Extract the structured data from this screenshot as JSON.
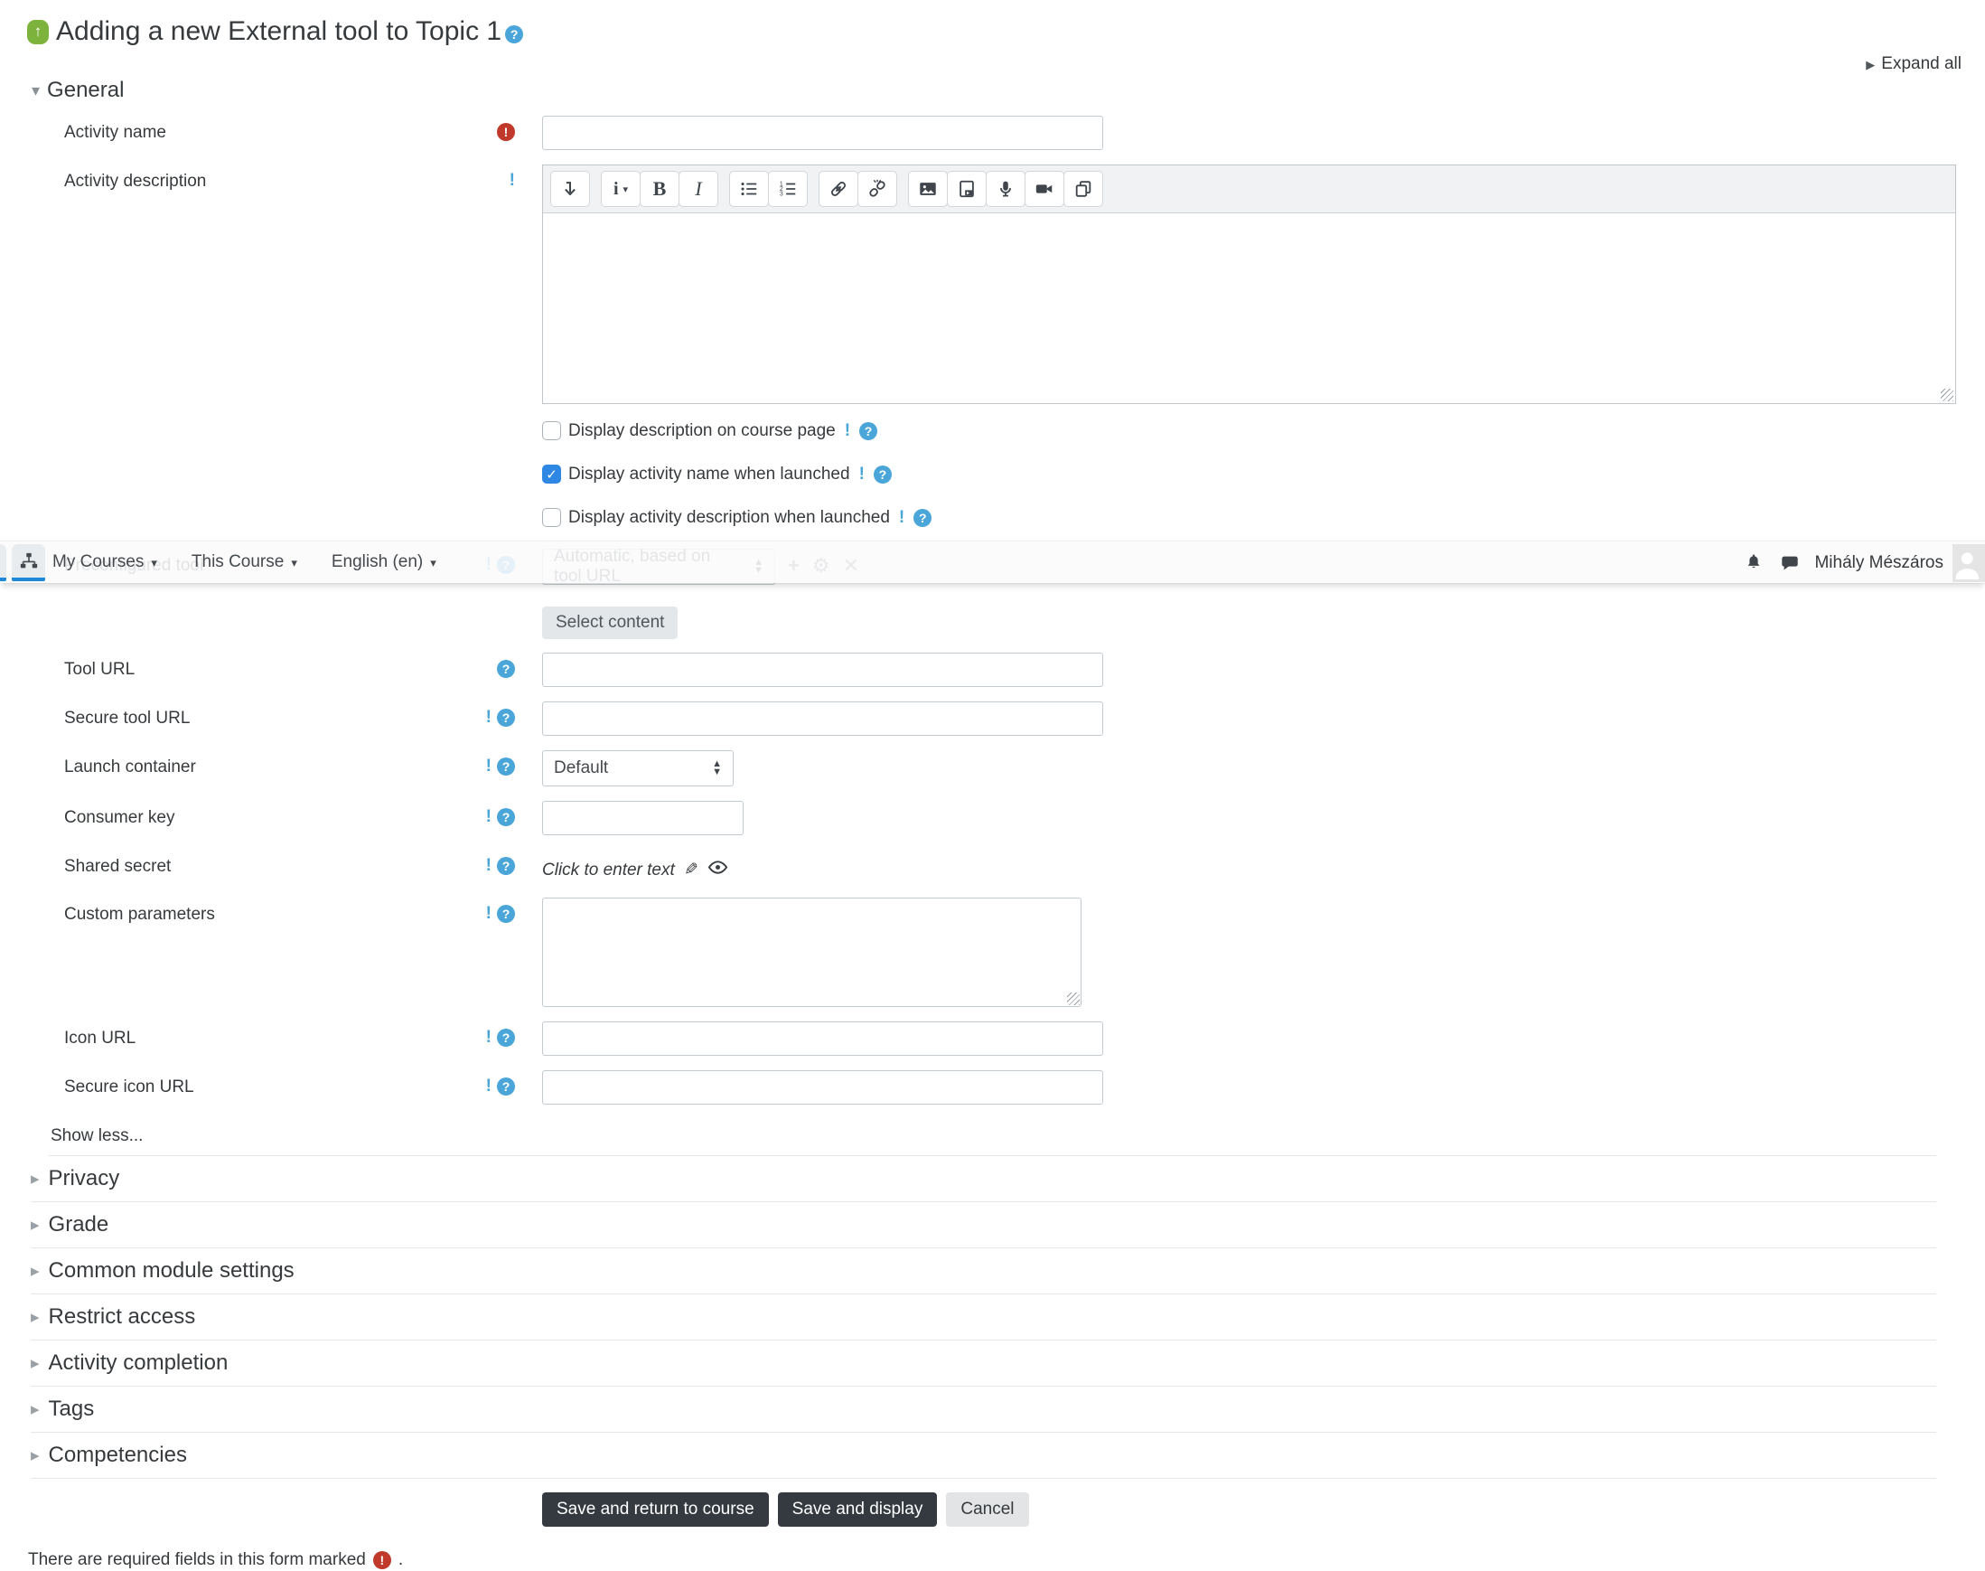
{
  "header": {
    "title": "Adding a new External tool to Topic 1",
    "expand_all_label": "Expand all"
  },
  "navbar": {
    "menus": [
      "My Courses",
      "This Course",
      "English (en)"
    ],
    "user_name": "Mihály Mészáros",
    "icons": [
      "site-navigation-icon",
      "notifications-bell-icon",
      "messages-icon",
      "avatar"
    ]
  },
  "general_section": {
    "label": "General"
  },
  "fields": {
    "activity_name": {
      "label": "Activity name",
      "value": "",
      "required": true
    },
    "activity_description": {
      "label": "Activity description",
      "value": ""
    },
    "editor_toolbar_icons": [
      "collapse-toolbar",
      "paragraph-styles",
      "bold",
      "italic",
      "unordered-list",
      "ordered-list",
      "link",
      "unlink",
      "image",
      "media",
      "record-audio",
      "record-video",
      "manage-files"
    ],
    "checkboxes": [
      {
        "label": "Display description on course page",
        "checked": false
      },
      {
        "label": "Display activity name when launched",
        "checked": true
      },
      {
        "label": "Display activity description when launched",
        "checked": false
      }
    ],
    "preconfigured_tool": {
      "label": "Preconfigured tool",
      "select_value": "Automatic, based on tool URL"
    },
    "select_content_label": "Select content",
    "tool_url": {
      "label": "Tool URL",
      "value": ""
    },
    "secure_tool_url": {
      "label": "Secure tool URL",
      "value": ""
    },
    "launch_container": {
      "label": "Launch container",
      "select_value": "Default"
    },
    "consumer_key": {
      "label": "Consumer key",
      "value": ""
    },
    "shared_secret": {
      "label": "Shared secret",
      "value_text": "Click to enter text"
    },
    "custom_parameters": {
      "label": "Custom parameters",
      "value": ""
    },
    "icon_url": {
      "label": "Icon URL",
      "value": ""
    },
    "secure_icon_url": {
      "label": "Secure icon URL",
      "value": ""
    }
  },
  "show_less_label": "Show less...",
  "collapsed_sections": [
    {
      "label": "Privacy"
    },
    {
      "label": "Grade"
    },
    {
      "label": "Common module settings"
    },
    {
      "label": "Restrict access"
    },
    {
      "label": "Activity completion"
    },
    {
      "label": "Tags"
    },
    {
      "label": "Competencies"
    }
  ],
  "actions": {
    "save_return_label": "Save and return to course",
    "save_display_label": "Save and display",
    "cancel_label": "Cancel"
  },
  "footer_note": {
    "text_before": "There are required fields in this form marked",
    "text_after": "."
  },
  "colors": {
    "accent_blue": "#1e88d8",
    "help_blue": "#4aa6d8",
    "required_red": "#c0392b",
    "button_dark": "#343a40",
    "tool_icon_green": "#7db33d",
    "checkbox_checked_blue": "#2e87e2"
  }
}
